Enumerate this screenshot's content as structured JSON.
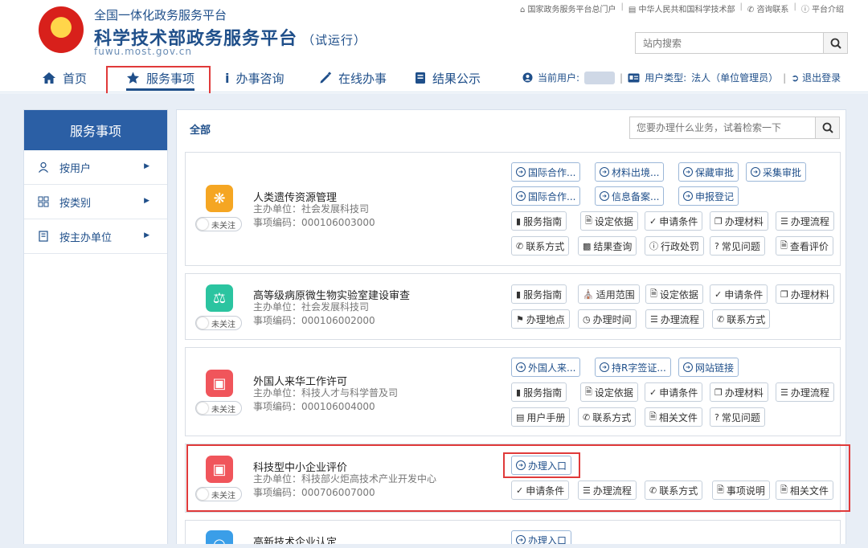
{
  "header": {
    "platform_sub": "全国一体化政务服务平台",
    "title": "科学技术部政务服务平台",
    "trial": "（试运行）",
    "url": "fuwu.most.gov.cn",
    "top_links": [
      "国家政务服务平台总门户",
      "中华人民共和国科学技术部",
      "咨询联系",
      "平台介绍"
    ],
    "search_placeholder": "站内搜索"
  },
  "nav": {
    "items": [
      "首页",
      "服务事项",
      "办事咨询",
      "在线办事",
      "结果公示"
    ],
    "active": "服务事项"
  },
  "user": {
    "current_label": "当前用户:",
    "type_label": "用户类型:",
    "type_value": "法人（单位管理员）",
    "logout": "退出登录"
  },
  "sidebar": {
    "title": "服务事项",
    "items": [
      "按用户",
      "按类别",
      "按主办单位"
    ]
  },
  "main": {
    "title": "全部",
    "search_placeholder": "您要办理什么业务，试着检索一下"
  },
  "services": [
    {
      "name": "人类遗传资源管理",
      "org": "主办单位：社会发展科技司",
      "code": "事项编码：000106003000",
      "follow": "未关注",
      "icon_color": "#f5a623",
      "links": [
        "国际合作...",
        "材料出境...",
        "保藏审批",
        "采集审批",
        "国际合作...",
        "信息备案...",
        "申报登记"
      ],
      "actions": [
        "服务指南",
        "设定依据",
        "申请条件",
        "办理材料",
        "办理流程",
        "联系方式",
        "结果查询",
        "行政处罚",
        "常见问题",
        "查看评价"
      ]
    },
    {
      "name": "高等级病原微生物实验室建设审查",
      "org": "主办单位：社会发展科技司",
      "code": "事项编码：000106002000",
      "follow": "未关注",
      "icon_color": "#2bc4a0",
      "links": [],
      "actions": [
        "服务指南",
        "适用范围",
        "设定依据",
        "申请条件",
        "办理材料",
        "办理地点",
        "办理时间",
        "办理流程",
        "联系方式"
      ]
    },
    {
      "name": "外国人来华工作许可",
      "org": "主办单位：科技人才与科学普及司",
      "code": "事项编码：000106004000",
      "follow": "未关注",
      "icon_color": "#f0555b",
      "links": [
        "外国人来...",
        "持R字签证...",
        "网站链接"
      ],
      "actions": [
        "服务指南",
        "设定依据",
        "申请条件",
        "办理材料",
        "办理流程",
        "用户手册",
        "联系方式",
        "相关文件",
        "常见问题"
      ]
    },
    {
      "name": "科技型中小企业评价",
      "org": "主办单位：科技部火炬高技术产业开发中心",
      "code": "事项编码：000706007000",
      "follow": "未关注",
      "icon_color": "#f0555b",
      "links": [
        "办理入口"
      ],
      "actions": [
        "申请条件",
        "办理流程",
        "联系方式",
        "事项说明",
        "相关文件"
      ]
    },
    {
      "name": "高新技术企业认定",
      "icon_color": "#3a9ee8",
      "links": [
        "办理入口"
      ],
      "actions": []
    }
  ]
}
